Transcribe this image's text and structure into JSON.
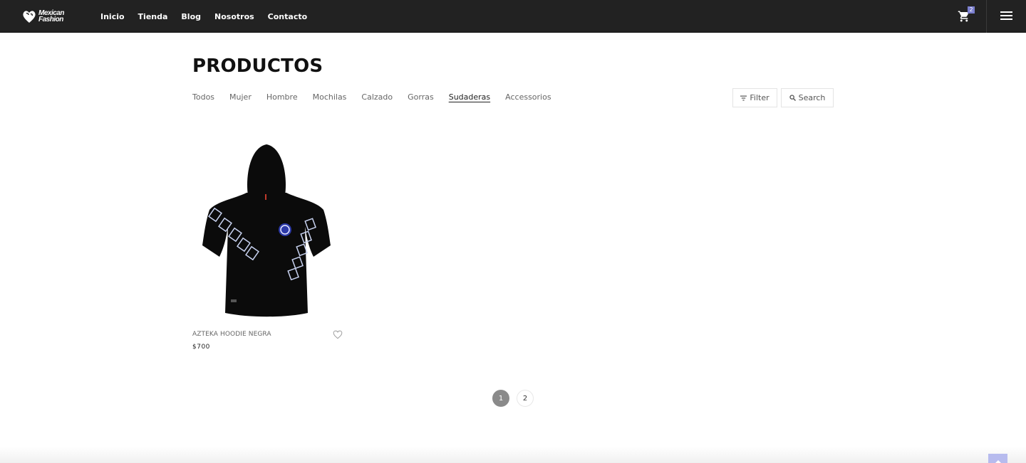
{
  "brand": {
    "line1": "Mexican",
    "line2": "Fashion",
    "logo_icon": "heart-logo-icon"
  },
  "nav": {
    "items": [
      {
        "label": "Inicio"
      },
      {
        "label": "Tienda"
      },
      {
        "label": "Blog"
      },
      {
        "label": "Nosotros"
      },
      {
        "label": "Contacto"
      }
    ]
  },
  "cart": {
    "count": "2",
    "icon": "cart-icon"
  },
  "menu": {
    "icon": "hamburger-menu-icon"
  },
  "page": {
    "title": "PRODUCTOS"
  },
  "categories": {
    "items": [
      {
        "label": "Todos"
      },
      {
        "label": "Mujer"
      },
      {
        "label": "Hombre"
      },
      {
        "label": "Mochilas"
      },
      {
        "label": "Calzado"
      },
      {
        "label": "Gorras"
      },
      {
        "label": "Sudaderas"
      },
      {
        "label": "Accessorios"
      }
    ],
    "active": "Sudaderas"
  },
  "tools": {
    "filter_label": "Filter",
    "search_label": "Search"
  },
  "products": [
    {
      "name": "AZTEKA HOODIE NEGRA",
      "price": "$700"
    }
  ],
  "pagination": {
    "pages": [
      "1",
      "2"
    ],
    "current": "1"
  },
  "colors": {
    "topbar": "#222222",
    "accent": "#7b7fcf",
    "back_to_top": "#b7bbee"
  }
}
